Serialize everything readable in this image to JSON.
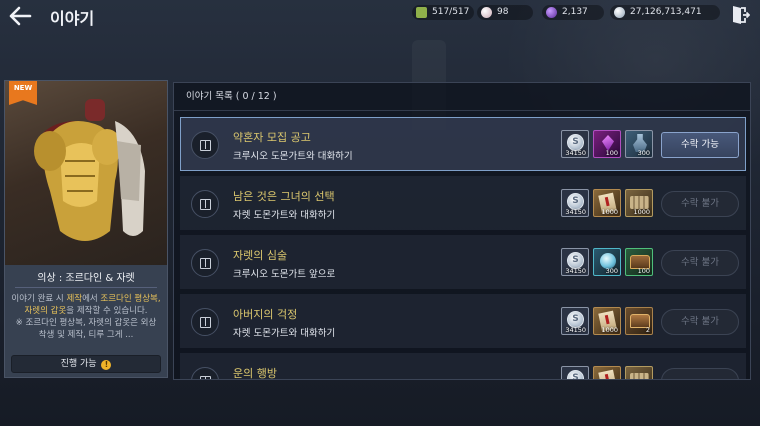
{
  "header": {
    "title": "이야기",
    "currencies": [
      {
        "name": "stamina",
        "icon": "stamina-icon",
        "value": "517/517"
      },
      {
        "name": "pearl",
        "icon": "pearl-icon",
        "value": "98"
      },
      {
        "name": "gem",
        "icon": "gem-icon",
        "value": "2,137"
      },
      {
        "name": "silver",
        "icon": "silver-coin-icon",
        "value": "27,126,713,471"
      }
    ]
  },
  "card": {
    "badge": "NEW",
    "name": "의상 : 조르다인 & 자렛",
    "desc_parts": {
      "p1": "이야기 완료 시 ",
      "p2": "제작",
      "p3": "에서 ",
      "p4": "조르다인 평상복, 자렛의 갑옷",
      "p5": "을 제작할 수 있습니다.",
      "p6": "※ 조르다인 평상복, 자렛의 갑옷은 외상 착생 및 제작, 티루 그게 ..."
    },
    "action_label": "진행 가능",
    "action_badge": "!"
  },
  "list": {
    "header": "이야기 목록 ( 0 / 12 )",
    "rows": [
      {
        "title": "약혼자 모집 공고",
        "subtitle": "크루시오 도몬가트와 대화하기",
        "rewards": [
          {
            "icon": "silver-coin-icon",
            "qty": "34150"
          },
          {
            "icon": "gem-icon",
            "qty": "100"
          },
          {
            "icon": "potion-icon",
            "qty": "300"
          }
        ],
        "button": "수락 가능"
      },
      {
        "title": "남은 것은 그녀의 선택",
        "subtitle": "자렛 도몬가트와 대화하기",
        "rewards": [
          {
            "icon": "silver-coin-icon",
            "qty": "34150"
          },
          {
            "icon": "scroll-icon",
            "qty": "1000"
          },
          {
            "icon": "stone-icon",
            "qty": "1000"
          }
        ],
        "button": "수락 불가"
      },
      {
        "title": "자렛의 심술",
        "subtitle": "크루시오 도몬가트 앞으로",
        "rewards": [
          {
            "icon": "silver-coin-icon",
            "qty": "34150"
          },
          {
            "icon": "orb-icon",
            "qty": "300"
          },
          {
            "icon": "chest-icon",
            "qty": "100"
          }
        ],
        "button": "수락 불가"
      },
      {
        "title": "아버지의 걱정",
        "subtitle": "자렛 도몬가트와 대화하기",
        "rewards": [
          {
            "icon": "silver-coin-icon",
            "qty": "34150"
          },
          {
            "icon": "scroll-icon",
            "qty": "1000"
          },
          {
            "icon": "chest-icon",
            "qty": "2"
          }
        ],
        "button": "수락 불가"
      },
      {
        "title": "운의 행방",
        "subtitle": "",
        "rewards": [],
        "button": ""
      }
    ]
  },
  "colors": {
    "accent": "#7fa0c9",
    "highlight": "#e8c25a",
    "title_gold": "#dcc86e"
  }
}
